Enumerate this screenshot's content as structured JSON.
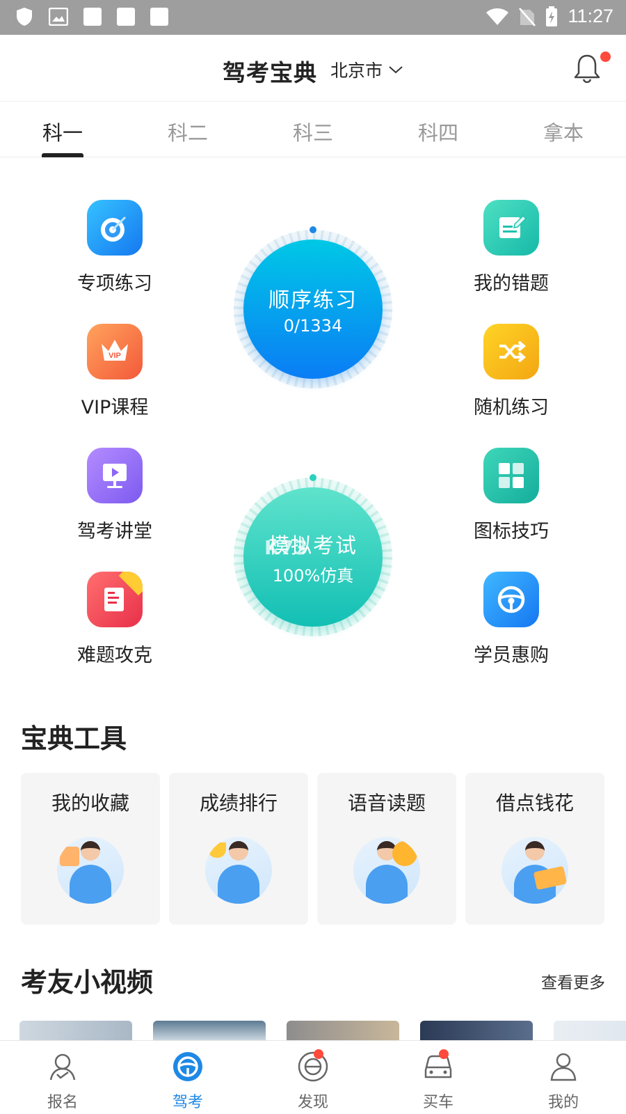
{
  "status_bar": {
    "time": "11:27"
  },
  "header": {
    "title": "驾考宝典",
    "city": "北京市"
  },
  "tabs": [
    {
      "label": "科一"
    },
    {
      "label": "科二"
    },
    {
      "label": "科三"
    },
    {
      "label": "科四"
    },
    {
      "label": "拿本"
    }
  ],
  "features_left": [
    {
      "label": "专项练习",
      "icon": "target-icon"
    },
    {
      "label": "VIP课程",
      "icon": "vip-crown-icon"
    },
    {
      "label": "驾考讲堂",
      "icon": "lecture-screen-icon"
    },
    {
      "label": "难题攻克",
      "icon": "hard-question-icon"
    }
  ],
  "features_right": [
    {
      "label": "我的错题",
      "icon": "wrong-questions-icon"
    },
    {
      "label": "随机练习",
      "icon": "shuffle-icon"
    },
    {
      "label": "图标技巧",
      "icon": "grid-icon"
    },
    {
      "label": "学员惠购",
      "icon": "steering-wheel-icon"
    }
  ],
  "practice_circle": {
    "title": "顺序练习",
    "progress": "0/1334"
  },
  "exam_circle": {
    "title": "模拟考试",
    "subtitle": "100%仿真"
  },
  "watermark": "K73",
  "tools": {
    "title": "宝典工具",
    "items": [
      {
        "label": "我的收藏"
      },
      {
        "label": "成绩排行"
      },
      {
        "label": "语音读题"
      },
      {
        "label": "借点钱花"
      }
    ]
  },
  "videos": {
    "title": "考友小视频",
    "more": "查看更多"
  },
  "bottom_nav": [
    {
      "label": "报名",
      "icon": "signup-icon"
    },
    {
      "label": "驾考",
      "icon": "steering-wheel-icon"
    },
    {
      "label": "发现",
      "icon": "discover-icon"
    },
    {
      "label": "买车",
      "icon": "car-icon"
    },
    {
      "label": "我的",
      "icon": "profile-icon"
    }
  ],
  "colors": {
    "accent": "#1e88e5",
    "badge": "#ff4a3c",
    "practice_gradient": [
      "#00c6e8",
      "#0a7df5"
    ],
    "exam_gradient": [
      "#56e0c9",
      "#14c2b8"
    ]
  }
}
